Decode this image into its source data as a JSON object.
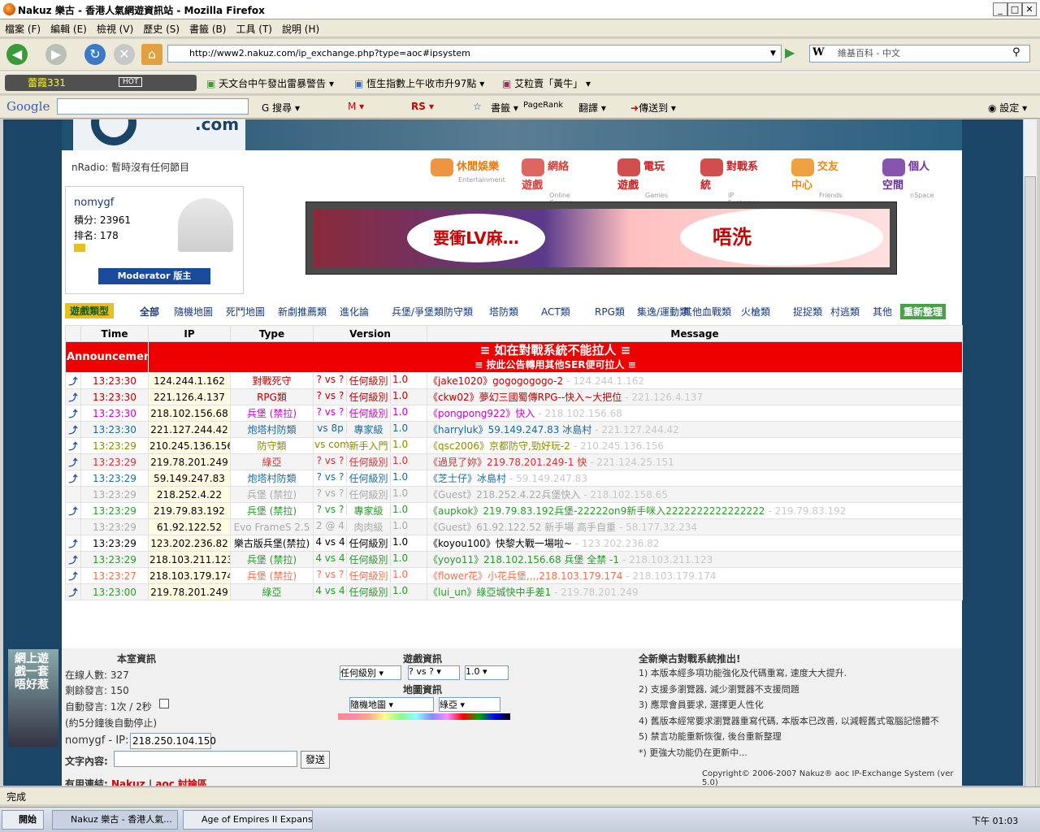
{
  "window": {
    "title": "Nakuz 樂古 - 香港人氣網遊資訊站 - Mozilla Firefox"
  },
  "menu": [
    "檔案 (F)",
    "編輯 (E)",
    "檢視 (V)",
    "歷史 (S)",
    "書籤 (B)",
    "工具 (T)",
    "說明 (H)"
  ],
  "nav": {
    "url": "http://www2.nakuz.com/ip_exchange.php?type=aoc#ipsystem",
    "search_engine": "W",
    "search_placeholder": "維基百科 - 中文"
  },
  "bookmarks": {
    "radio": "蕾霞331",
    "hot": "HOT",
    "items": [
      "天文台中午發出雷暴警告",
      "恆生指數上午收市升97點",
      "艾粒賣「黃牛」"
    ]
  },
  "google": {
    "logo": "Google",
    "search": "搜尋",
    "bookmarks": "書籤",
    "pagerank": "PageRank",
    "translate": "翻譯",
    "sendto": "傳送到",
    "settings": "設定"
  },
  "page": {
    "nradio": "nRadio: 暫時沒有任何節目",
    "navlinks": [
      {
        "t": "休閒娛樂",
        "s": "Entertainment",
        "c": "#e87a10"
      },
      {
        "t": "網絡遊戲",
        "s": "Online Games",
        "c": "#d4403a"
      },
      {
        "t": "電玩遊戲",
        "s": "Games",
        "c": "#c42222"
      },
      {
        "t": "對戰系統",
        "s": "IP Exchange",
        "c": "#c42222"
      },
      {
        "t": "交友中心",
        "s": "Friends",
        "c": "#e88a10"
      },
      {
        "t": "個人空間",
        "s": "nSpace",
        "c": "#6a2a9a"
      }
    ],
    "profile": {
      "name": "nomygf",
      "score_label": "積分:",
      "score": "23961",
      "rank_label": "排名:",
      "rank": "178",
      "badge": "Moderator 版主"
    },
    "ad": {
      "left": "要衝LV麻…",
      "right": "唔洗"
    },
    "cat_title": "遊戲類型",
    "categories": [
      "全部",
      "隨機地圖",
      "死鬥地圖",
      "新劇推薦類",
      "進化論",
      "兵堡/爭堡類",
      "防守類",
      "塔防類",
      "ACT類",
      "RPG類",
      "集逸/運動類",
      "其他血戰類",
      "火槍類",
      "捉捉類",
      "村逃類",
      "其他"
    ],
    "refresh": "重新整理",
    "headers": [
      "",
      "Time",
      "IP",
      "Type",
      "Version",
      "Message"
    ],
    "announcement": {
      "label": "Announcement",
      "line1": "≡ 如在對戰系統不能拉人 ≡",
      "line2": "≡ 按此公告轉用其他SER便可拉人 ≡"
    },
    "rows": [
      {
        "icon": true,
        "time": "13:23:30",
        "ip": "124.244.1.162",
        "type": "對戰死守",
        "vs": "? vs ?",
        "lvl": "任何級別",
        "ver": "1.0",
        "msg": "《jake1020》gogogogogo-2",
        "tail": "- 124.244.1.162",
        "tc": "#c00000",
        "mc": "#c00000"
      },
      {
        "icon": true,
        "time": "13:23:30",
        "ip": "221.126.4.137",
        "type": "RPG類",
        "vs": "? vs ?",
        "lvl": "任何級別",
        "ver": "1.0",
        "msg": "《ckw02》夢幻三國蜀傳RPG--快入~大把位",
        "tail": "- 221.126.4.137",
        "tc": "#c00000",
        "mc": "#c00000"
      },
      {
        "icon": true,
        "time": "13:23:30",
        "ip": "218.102.156.68",
        "type": "兵堡 (禁拉)",
        "vs": "? vs ?",
        "lvl": "任何級別",
        "ver": "1.0",
        "msg": "《pongpong922》快入",
        "tail": "- 218.102.156.68",
        "tc": "#cc00cc",
        "mc": "#cc00cc"
      },
      {
        "icon": true,
        "time": "13:23:30",
        "ip": "221.127.244.42",
        "type": "炮塔村防類",
        "vs": "vs 8p",
        "lvl": "專家級",
        "ver": "1.0",
        "msg": "《harryluk》59.149.247.83 冰島村",
        "tail": "- 221.127.244.42",
        "tc": "#1a6aa0",
        "mc": "#1a6aa0"
      },
      {
        "icon": true,
        "time": "13:23:29",
        "ip": "210.245.136.156",
        "type": "防守類",
        "vs": "vs com",
        "lvl": "新手入門",
        "ver": "1.0",
        "msg": "《qsc2006》京都防守,勁好玩-2",
        "tail": "- 210.245.136.156",
        "tc": "#8a8a00",
        "mc": "#8a8a00"
      },
      {
        "icon": true,
        "time": "13:23:29",
        "ip": "219.78.201.249",
        "type": "綠亞",
        "vs": "? vs ?",
        "lvl": "任何級別",
        "ver": "1.0",
        "msg": "《過見了妳》219.78.201.249-1 快",
        "tail": "- 221.124.25.151",
        "tc": "#e03030",
        "mc": "#e03030"
      },
      {
        "icon": true,
        "time": "13:23:29",
        "ip": "59.149.247.83",
        "type": "炮塔村防類",
        "vs": "? vs ?",
        "lvl": "任何級別",
        "ver": "1.0",
        "msg": "《芝士仔》冰島村",
        "tail": "- 59.149.247.83",
        "tc": "#1a6aa0",
        "mc": "#1a6aa0"
      },
      {
        "icon": false,
        "time": "13:23:29",
        "ip": "218.252.4.22",
        "type": "兵堡 (禁拉)",
        "vs": "? vs ?",
        "lvl": "任何級別",
        "ver": "1.0",
        "msg": "《Guest》218.252.4.22兵堡快入",
        "tail": "- 218.102.158.65",
        "tc": "#aaaaaa",
        "mc": "#aaaaaa"
      },
      {
        "icon": true,
        "time": "13:23:29",
        "ip": "219.79.83.192",
        "type": "兵堡 (禁拉)",
        "vs": "? vs ?",
        "lvl": "專家級",
        "ver": "1.0",
        "msg": "《aupkok》219.79.83.192兵堡-22222on9新手咪入2222222222222222",
        "tail": "- 219.79.83.192",
        "tc": "#2a9a2a",
        "mc": "#2a9a2a"
      },
      {
        "icon": false,
        "time": "13:23:29",
        "ip": "61.92.122.52",
        "type": "Evo FrameS 2.5",
        "vs": "2 @ 4",
        "lvl": "肉肉級",
        "ver": "1.0",
        "msg": "《Guest》61.92.122.52 新手場 高手自重",
        "tail": "- 58.177.32.234",
        "tc": "#aaaaaa",
        "mc": "#aaaaaa"
      },
      {
        "icon": true,
        "time": "13:23:29",
        "ip": "123.202.236.82",
        "type": "樂古版兵堡(禁拉)",
        "vs": "4 vs 4",
        "lvl": "任何級別",
        "ver": "1.0",
        "msg": "《koyou100》快黎大戰一場啦~",
        "tail": "- 123.202.236.82",
        "tc": "#000000",
        "mc": "#000000"
      },
      {
        "icon": true,
        "time": "13:23:29",
        "ip": "218.103.211.123",
        "type": "兵堡 (禁拉)",
        "vs": "4 vs 4",
        "lvl": "任何級別",
        "ver": "1.0",
        "msg": "《yoyo11》218.102.156.68 兵堡 全禁 -1",
        "tail": "- 218.103.211.123",
        "tc": "#2a9a2a",
        "mc": "#2a9a2a"
      },
      {
        "icon": true,
        "time": "13:23:27",
        "ip": "218.103.179.174",
        "type": "兵堡 (禁拉)",
        "vs": "? vs ?",
        "lvl": "任何級別",
        "ver": "1.0",
        "msg": "《flower花》小花兵堡,,,,218.103.179.174",
        "tail": "- 218.103.179.174",
        "tc": "#f07050",
        "mc": "#f07050"
      },
      {
        "icon": true,
        "time": "13:23:00",
        "ip": "219.78.201.249",
        "type": "綠亞",
        "vs": "4 vs 4",
        "lvl": "任何級別",
        "ver": "1.0",
        "msg": "《lui_un》綠亞城快中手差1",
        "tail": "- 219.78.201.249",
        "tc": "#2a9a2a",
        "mc": "#2a9a2a"
      }
    ],
    "room": {
      "title": "本室資訊",
      "online": "在線人數: 327",
      "remain": "剩餘發言: 150",
      "auto": "自動發言: 1次 / 2秒",
      "autonote": "(約5分鐘後自動停止)",
      "ip_label": "nomygf - IP:",
      "ip_value": "218.250.104.150",
      "text_label": "文字內容:",
      "send": "發送",
      "links_label": "有用連結:",
      "link1": "Nakuz",
      "link2": "aoc 討論區"
    },
    "game": {
      "title": "遊戲資訊",
      "level": "任何級別",
      "vs": "? vs ?",
      "ver": "1.0",
      "map_title": "地圖資訊",
      "map": "隨機地圖",
      "map2": "綠亞"
    },
    "news": {
      "title": "全新樂古對戰系統推出!",
      "items": [
        "1) 本版本經多項功能強化及代碼重寫, 速度大大提升.",
        "2) 支援多瀏覽器, 減少瀏覽器不支援問題",
        "3) 應眾會員要求, 選擇更人性化",
        "4) 舊版本經常要求瀏覽器重寫代碼, 本版本已改善, 以減輕舊式電腦記憶體不",
        "5) 禁言功能重新恢復, 後台重新整理",
        "*) 更強大功能仍在更新中..."
      ],
      "copyright": "Copyright© 2006-2007  Nakuz® aoc IP-Exchange System (ver 5.0)"
    },
    "leftad": "網上遊戲一套唔好惹"
  },
  "status": "完成",
  "taskbar": {
    "start": "開始",
    "t1": "Nakuz 樂古 - 香港人氣...",
    "t2": "Age of Empires II Expans...",
    "clock": "下午 01:03"
  }
}
